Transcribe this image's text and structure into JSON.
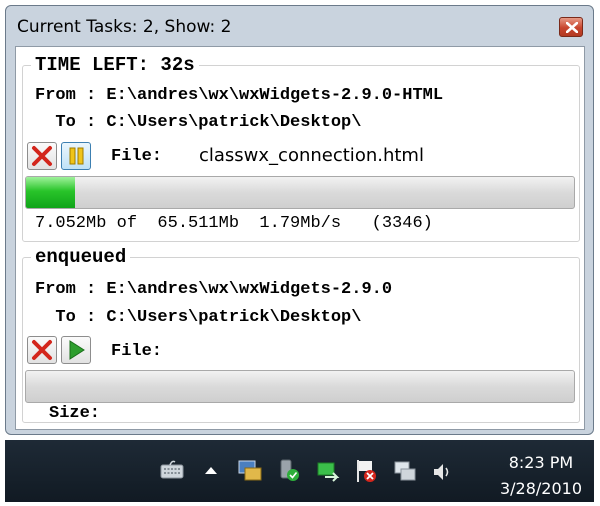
{
  "window": {
    "title": "Current Tasks: 2, Show: 2"
  },
  "tasks": [
    {
      "header": "TIME LEFT: 32s",
      "from_line": "From : E:\\andres\\wx\\wxWidgets-2.9.0-HTML",
      "to_line": "  To : C:\\Users\\patrick\\Desktop\\",
      "file_label": "File:",
      "file_name": "classwx_connection.html",
      "progress": 0.089,
      "stats": "7.052Mb of  65.511Mb  1.79Mb/s   (3346)",
      "state": "downloading"
    },
    {
      "header": "enqueued",
      "from_line": "From : E:\\andres\\wx\\wxWidgets-2.9.0",
      "to_line": "  To : C:\\Users\\patrick\\Desktop\\",
      "file_label": "File:",
      "file_name": "",
      "progress": 0,
      "stats": "Size:",
      "state": "enqueued"
    }
  ],
  "taskbar": {
    "time": "8:23 PM",
    "date": "3/28/2010"
  },
  "icons": {
    "close": "close-icon",
    "cancel": "red-x-icon",
    "pause": "pause-icon",
    "start": "play-icon"
  },
  "colors": {
    "progress_green": "#1db424",
    "cancel_red": "#d3261c",
    "pause_yellow": "#f0c419",
    "play_green": "#2e9e2e"
  }
}
